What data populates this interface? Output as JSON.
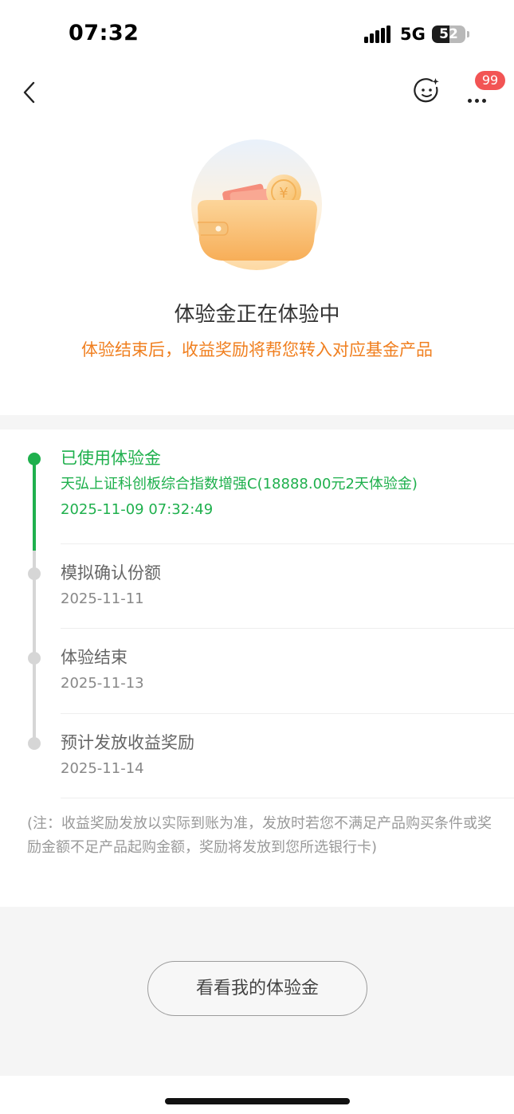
{
  "status_bar": {
    "time": "07:32",
    "network": "5G",
    "battery": "52",
    "battery_level": 0.52
  },
  "nav": {
    "back_icon": "chevron-left-icon",
    "assistant_icon": "smiley-assistant-icon",
    "more_icon": "more-dots-icon",
    "badge_count": "99"
  },
  "hero": {
    "illustration": "wallet-coin-icon",
    "title": "体验金正在体验中",
    "subtitle": "体验结束后，收益奖励将帮您转入对应基金产品"
  },
  "timeline": {
    "steps": [
      {
        "title": "已使用体验金",
        "detail": "天弘上证科创板综合指数增强C(18888.00元2天体验金)",
        "time": "2025-11-09 07:32:49",
        "status": "done"
      },
      {
        "title": "模拟确认份额",
        "time": "2025-11-11",
        "status": "pending"
      },
      {
        "title": "体验结束",
        "time": "2025-11-13",
        "status": "pending"
      },
      {
        "title": "预计发放收益奖励",
        "time": "2025-11-14",
        "status": "pending"
      }
    ]
  },
  "note": "(注：收益奖励发放以实际到账为准，发放时若您不满足产品购买条件或奖励金额不足产品起购金额，奖励将发放到您所选银行卡)",
  "action": {
    "label": "看看我的体验金"
  },
  "colors": {
    "accent_green": "#1fb04d",
    "accent_orange": "#f07f1f",
    "badge_red": "#f25454",
    "inactive_gray": "#d6d6d6"
  }
}
